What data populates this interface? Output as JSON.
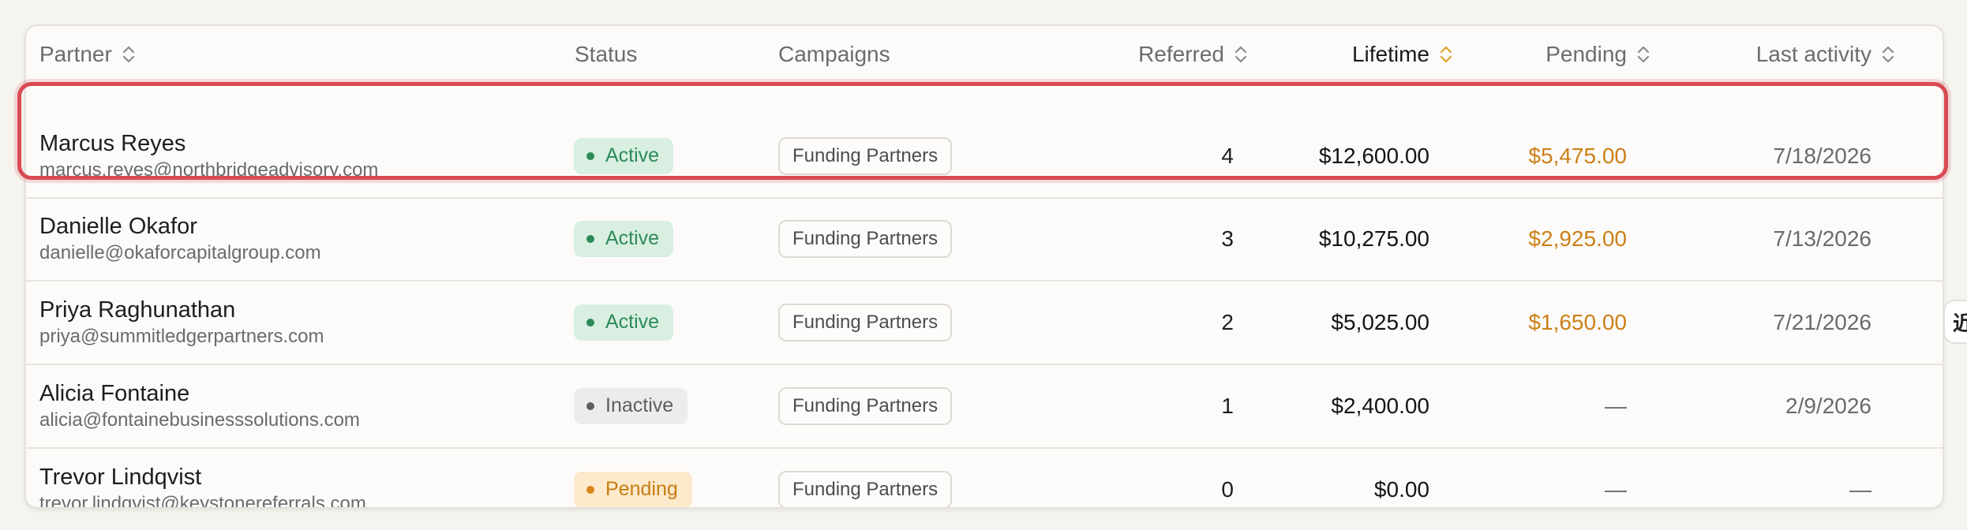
{
  "table": {
    "columns": {
      "partner": "Partner",
      "status": "Status",
      "campaigns": "Campaigns",
      "referred": "Referred",
      "lifetime": "Lifetime",
      "pending": "Pending",
      "last_activity": "Last activity"
    },
    "sorted_column": "Lifetime",
    "selected_row": 0,
    "rows": [
      {
        "name": "Marcus Reyes",
        "email": "marcus.reyes@northbridgeadvisory.com",
        "status": "Active",
        "campaign": "Funding Partners",
        "referred": "4",
        "lifetime": "$12,600.00",
        "pending": "$5,475.00",
        "last_activity": "7/18/2026"
      },
      {
        "name": "Danielle Okafor",
        "email": "danielle@okaforcapitalgroup.com",
        "status": "Active",
        "campaign": "Funding Partners",
        "referred": "3",
        "lifetime": "$10,275.00",
        "pending": "$2,925.00",
        "last_activity": "7/13/2026"
      },
      {
        "name": "Priya Raghunathan",
        "email": "priya@summitledgerpartners.com",
        "status": "Active",
        "campaign": "Funding Partners",
        "referred": "2",
        "lifetime": "$5,025.00",
        "pending": "$1,650.00",
        "last_activity": "7/21/2026"
      },
      {
        "name": "Alicia Fontaine",
        "email": "alicia@fontainebusinesssolutions.com",
        "status": "Inactive",
        "campaign": "Funding Partners",
        "referred": "1",
        "lifetime": "$2,400.00",
        "pending": "—",
        "last_activity": "2/9/2026"
      },
      {
        "name": "Trevor Lindqvist",
        "email": "trevor.lindqvist@keystonereferrals.com",
        "status": "Pending",
        "campaign": "Funding Partners",
        "referred": "0",
        "lifetime": "$0.00",
        "pending": "—",
        "last_activity": "—"
      }
    ]
  },
  "side_handle": {
    "glyph": "近"
  },
  "colors": {
    "accent_sort": "#e0a12a",
    "selection_outline": "#d94a52",
    "active": "#2e8a58",
    "inactive": "#5e5e63",
    "pending": "#c77d12",
    "pending_amount": "#cc7f17"
  },
  "icons": {
    "sort": "sort-updown-icon",
    "status_dot": "status-dot-icon"
  }
}
